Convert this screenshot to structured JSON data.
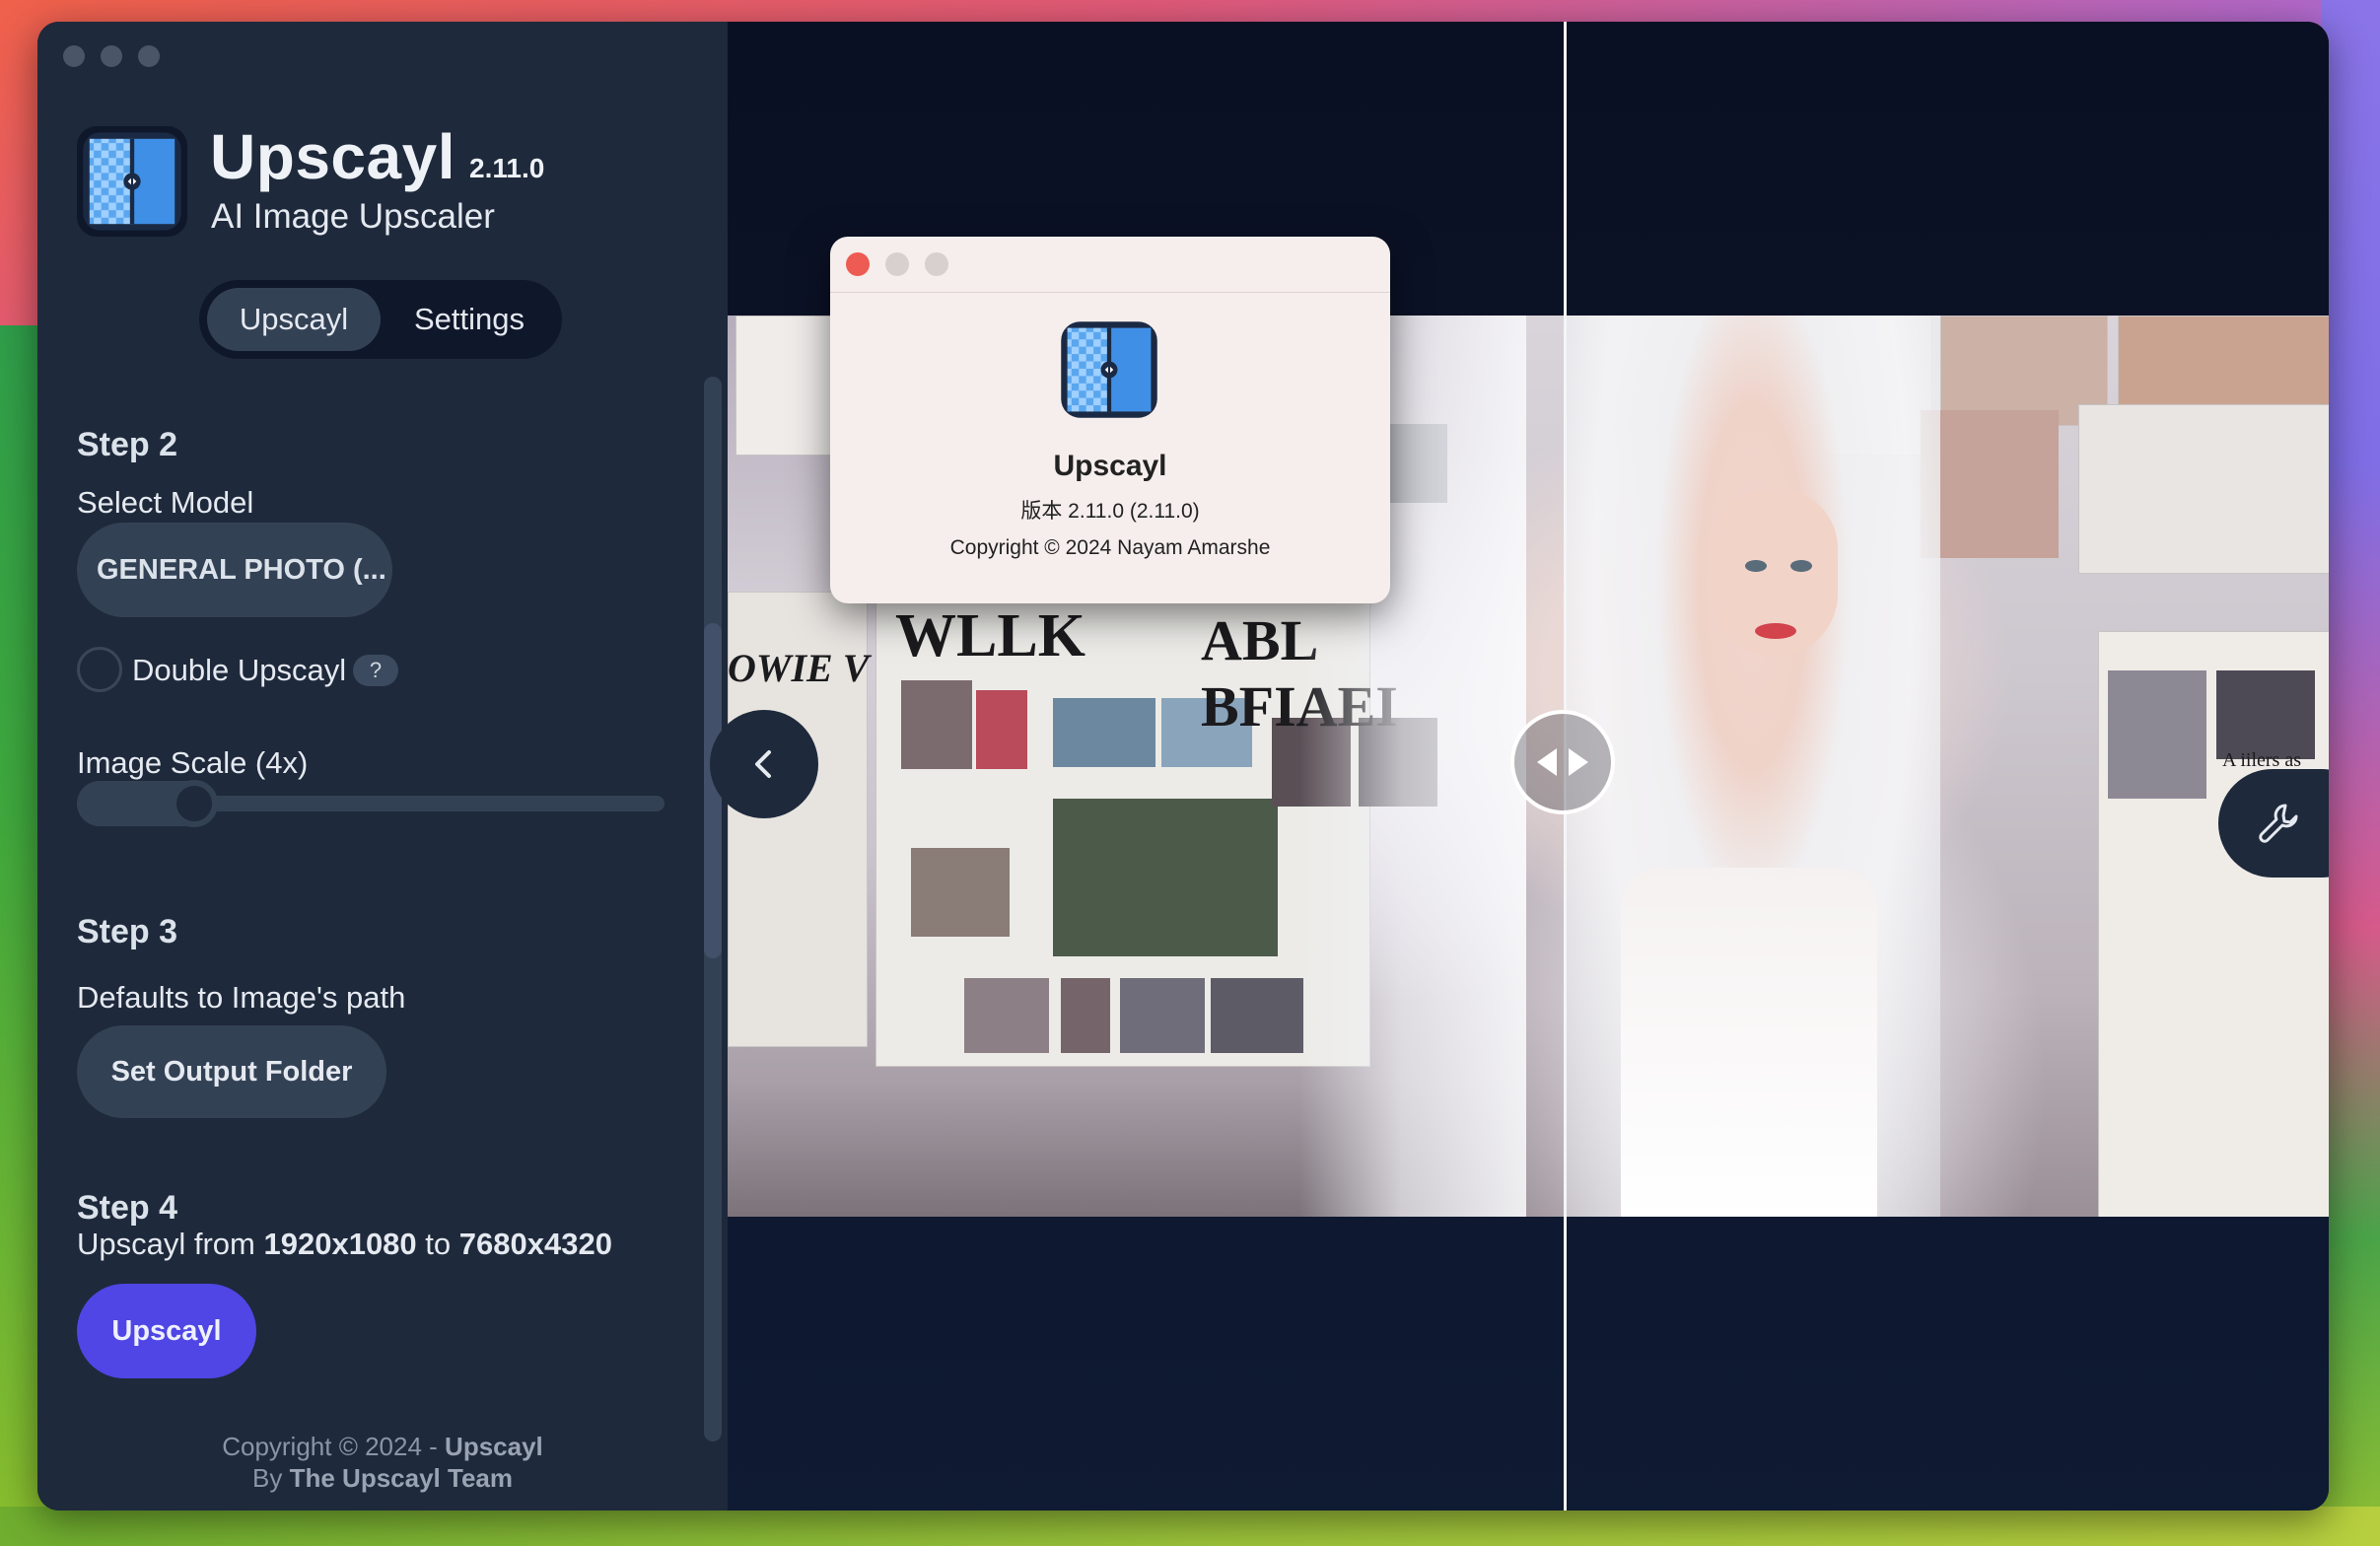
{
  "app": {
    "title": "Upscayl",
    "version": "2.11.0",
    "subtitle": "AI Image Upscaler"
  },
  "tabs": [
    {
      "label": "Upscayl",
      "active": true
    },
    {
      "label": "Settings",
      "active": false
    }
  ],
  "step2": {
    "title": "Step 2",
    "select_model_label": "Select Model",
    "model_value": "GENERAL PHOTO (...",
    "double_upscayl_label": "Double Upscayl",
    "double_upscayl_checked": false,
    "help_badge": "?",
    "scale_label": "Image Scale (4x)",
    "scale_fraction": 0.2
  },
  "step3": {
    "title": "Step 3",
    "path_text": "Defaults to Image's path",
    "output_button": "Set Output Folder"
  },
  "step4": {
    "title": "Step 4",
    "prefix": "Upscayl from",
    "from_res": "1920x1080",
    "mid": "to",
    "to_res": "7680x4320",
    "button": "Upscayl"
  },
  "footer": {
    "line1_prefix": "Copyright © 2024 -",
    "line1_brand": "Upscayl",
    "line2_prefix": "By",
    "line2_team": "The Upscayl Team"
  },
  "about_dialog": {
    "app_name": "Upscayl",
    "version_line": "版本 2.11.0 (2.11.0)",
    "copyright": "Copyright © 2024 Nayam Amarshe"
  },
  "image_headlines": {
    "left_1": "WLLK",
    "left_2": "ABL BFIAEI",
    "left_3": "OWIE V",
    "right_1": "A iilers as"
  },
  "icons": {
    "sidebar_toggle": "chevron-left-icon",
    "compare_handle": "left-right-arrows-icon",
    "tools": "wrench-icon"
  },
  "colors": {
    "sidebar_bg": "#1e293b",
    "accent": "#4f46e5",
    "close_red": "#ee5b52"
  }
}
